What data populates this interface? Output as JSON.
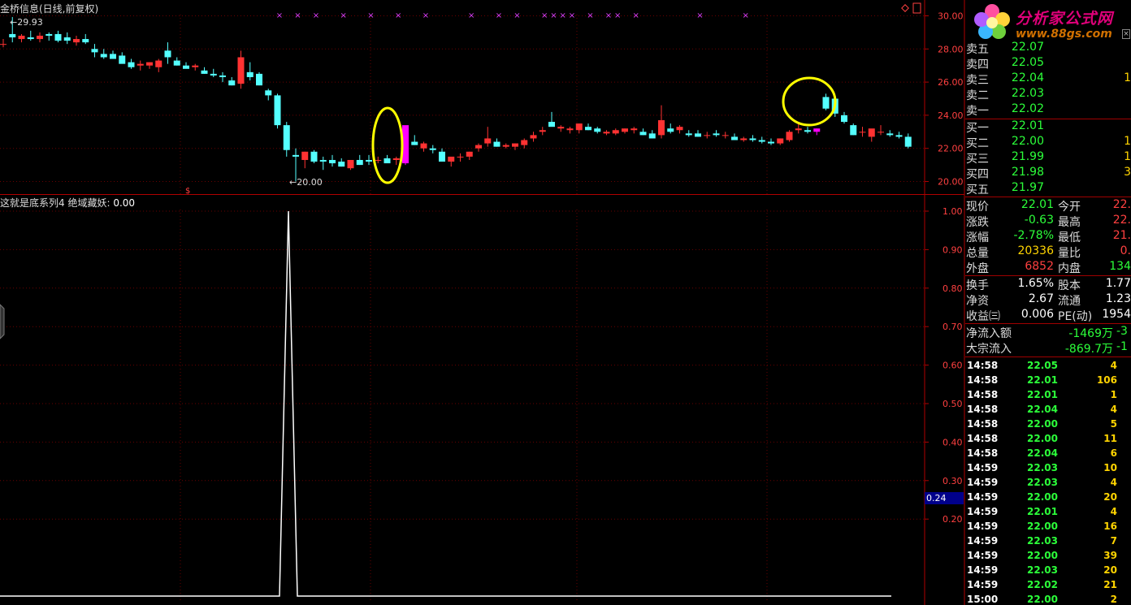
{
  "colors": {
    "background": "#000000",
    "frame": "#b00000",
    "up_candle": "#ff3232",
    "down_candle": "#54ffff",
    "signal_candle": "#ff00ff",
    "highlight_ellipse": "#ffff00",
    "indicator_line": "#ffffff",
    "gain": "#ff4040",
    "loss": "#2cff3a"
  },
  "chart": {
    "title": "金桥信息(日线,前复权)",
    "y_labels": [
      "30.00",
      "28.00",
      "26.00",
      "24.00",
      "22.00",
      "20.00"
    ],
    "y_values": [
      30,
      28,
      26,
      24,
      22,
      20
    ],
    "high_marker": "29.93",
    "low_marker": "20.00",
    "dollar_marker": "$",
    "top_right_icons": [
      "diamond-icon",
      "square-icon"
    ]
  },
  "indicator": {
    "name": "这就是底系列4",
    "series_label": "绝域藏妖:",
    "value": "0.00",
    "y_labels": [
      "1.00",
      "0.90",
      "0.80",
      "0.70",
      "0.60",
      "0.50",
      "0.40",
      "0.30",
      "0.20"
    ],
    "y_values": [
      1.0,
      0.9,
      0.8,
      0.7,
      0.6,
      0.5,
      0.4,
      0.3,
      0.2
    ],
    "current_value": "0.24"
  },
  "chart_data": {
    "type": "candlestick",
    "title": "金桥信息(日线,前复权)",
    "ylim": [
      19.2,
      30.4
    ],
    "ohlc": [
      [
        28.3,
        28.6,
        28.1,
        28.3
      ],
      [
        28.9,
        29.93,
        28.4,
        28.7
      ],
      [
        28.6,
        28.9,
        28.4,
        28.8
      ],
      [
        28.7,
        29.1,
        28.5,
        28.6
      ],
      [
        28.6,
        29.0,
        28.4,
        28.8
      ],
      [
        28.9,
        29.0,
        28.5,
        28.8
      ],
      [
        28.9,
        29.1,
        28.4,
        28.5
      ],
      [
        28.7,
        29.0,
        28.3,
        28.5
      ],
      [
        28.4,
        28.8,
        28.2,
        28.6
      ],
      [
        28.6,
        28.9,
        28.3,
        28.4
      ],
      [
        28.0,
        28.3,
        27.5,
        27.8
      ],
      [
        27.7,
        28.0,
        27.4,
        27.5
      ],
      [
        27.7,
        27.9,
        27.4,
        27.4
      ],
      [
        27.6,
        27.8,
        27.2,
        27.1
      ],
      [
        27.2,
        27.4,
        26.8,
        26.9
      ],
      [
        27.0,
        27.3,
        26.7,
        27.1
      ],
      [
        27.0,
        27.2,
        26.8,
        27.2
      ],
      [
        26.9,
        27.4,
        26.6,
        27.3
      ],
      [
        27.9,
        28.4,
        27.1,
        27.5
      ],
      [
        27.3,
        27.5,
        27.0,
        27.0
      ],
      [
        27.0,
        27.2,
        26.9,
        26.8
      ],
      [
        26.9,
        27.1,
        26.7,
        27.0
      ],
      [
        26.7,
        26.9,
        26.5,
        26.5
      ],
      [
        26.5,
        26.8,
        26.3,
        26.4
      ],
      [
        26.4,
        26.6,
        26.0,
        26.3
      ],
      [
        26.1,
        26.3,
        25.8,
        25.8
      ],
      [
        25.9,
        27.9,
        25.6,
        27.5
      ],
      [
        26.6,
        27.2,
        26.1,
        26.3
      ],
      [
        26.5,
        26.6,
        25.8,
        25.8
      ],
      [
        25.5,
        25.6,
        24.9,
        25.2
      ],
      [
        25.2,
        25.3,
        23.2,
        23.4
      ],
      [
        23.4,
        23.6,
        21.5,
        21.9
      ],
      [
        21.6,
        22.0,
        20.0,
        21.5
      ],
      [
        21.3,
        21.8,
        20.8,
        21.8
      ],
      [
        21.8,
        21.9,
        21.1,
        21.2
      ],
      [
        21.3,
        21.5,
        20.7,
        21.2
      ],
      [
        21.3,
        21.6,
        20.9,
        21.1
      ],
      [
        21.2,
        21.4,
        20.9,
        20.9
      ],
      [
        20.8,
        21.2,
        20.7,
        21.3
      ],
      [
        21.3,
        21.6,
        21.0,
        21.0
      ],
      [
        21.3,
        21.6,
        21.0,
        21.2
      ],
      [
        21.3,
        21.5,
        21.1,
        21.3
      ],
      [
        21.4,
        21.6,
        21.2,
        21.1
      ],
      [
        21.3,
        21.5,
        21.0,
        21.4
      ],
      [
        21.1,
        23.3,
        21.0,
        23.4
      ],
      [
        22.4,
        22.8,
        22.2,
        22.2
      ],
      [
        22.0,
        22.4,
        21.8,
        22.3
      ],
      [
        22.0,
        22.2,
        21.7,
        21.9
      ],
      [
        21.8,
        22.0,
        21.4,
        21.2
      ],
      [
        21.2,
        21.4,
        20.9,
        21.5
      ],
      [
        21.5,
        21.7,
        21.2,
        21.5
      ],
      [
        21.5,
        21.8,
        21.3,
        21.8
      ],
      [
        22.0,
        22.3,
        21.8,
        22.2
      ],
      [
        22.3,
        23.3,
        22.1,
        22.6
      ],
      [
        22.4,
        22.6,
        22.1,
        22.1
      ],
      [
        22.1,
        22.3,
        22.0,
        22.2
      ],
      [
        22.1,
        22.3,
        21.9,
        22.3
      ],
      [
        22.2,
        22.6,
        22.0,
        22.5
      ],
      [
        22.6,
        23.0,
        22.4,
        22.8
      ],
      [
        23.0,
        23.3,
        22.8,
        23.1
      ],
      [
        23.6,
        24.2,
        23.4,
        23.3
      ],
      [
        23.2,
        23.4,
        23.0,
        23.3
      ],
      [
        23.1,
        23.3,
        22.9,
        23.2
      ],
      [
        23.1,
        23.4,
        22.9,
        23.5
      ],
      [
        23.3,
        23.5,
        23.1,
        23.1
      ],
      [
        23.2,
        23.3,
        22.9,
        23.0
      ],
      [
        22.9,
        23.1,
        22.8,
        23.0
      ],
      [
        22.9,
        23.2,
        22.8,
        23.1
      ],
      [
        23.0,
        23.2,
        22.9,
        23.2
      ],
      [
        23.1,
        23.3,
        22.9,
        23.2
      ],
      [
        23.0,
        23.2,
        22.8,
        22.8
      ],
      [
        22.9,
        23.1,
        22.6,
        22.6
      ],
      [
        22.8,
        24.6,
        22.6,
        23.7
      ],
      [
        23.2,
        23.5,
        22.9,
        23.0
      ],
      [
        23.1,
        23.4,
        22.9,
        23.3
      ],
      [
        22.9,
        23.1,
        22.7,
        22.8
      ],
      [
        22.9,
        23.1,
        22.7,
        22.7
      ],
      [
        22.8,
        23.0,
        22.6,
        22.8
      ],
      [
        22.9,
        23.1,
        22.7,
        22.8
      ],
      [
        22.8,
        23.0,
        22.6,
        22.8
      ],
      [
        22.7,
        22.9,
        22.5,
        22.5
      ],
      [
        22.5,
        22.7,
        22.4,
        22.6
      ],
      [
        22.6,
        22.8,
        22.4,
        22.5
      ],
      [
        22.5,
        22.7,
        22.3,
        22.4
      ],
      [
        22.4,
        22.6,
        22.2,
        22.3
      ],
      [
        22.3,
        22.6,
        22.2,
        22.6
      ],
      [
        22.5,
        23.1,
        22.4,
        23.0
      ],
      [
        23.1,
        23.6,
        22.9,
        23.2
      ],
      [
        23.1,
        23.3,
        22.9,
        23.0
      ],
      [
        23.0,
        23.2,
        22.8,
        23.2
      ],
      [
        25.1,
        25.3,
        24.3,
        24.4
      ],
      [
        25.0,
        25.1,
        23.9,
        24.1
      ],
      [
        24.0,
        24.2,
        23.5,
        23.6
      ],
      [
        23.4,
        23.5,
        22.8,
        22.8
      ],
      [
        23.0,
        23.3,
        22.7,
        23.0
      ],
      [
        22.7,
        23.1,
        22.4,
        23.2
      ],
      [
        23.0,
        23.4,
        22.8,
        23.0
      ],
      [
        22.9,
        23.1,
        22.7,
        22.8
      ],
      [
        22.8,
        23.0,
        22.6,
        22.7
      ],
      [
        22.7,
        22.9,
        22.0,
        22.1
      ]
    ],
    "indicator_series": {
      "name": "绝域藏妖",
      "ylim": [
        0.0,
        1.05
      ],
      "peak_index": 32,
      "peak_value": 1.0
    }
  },
  "quote": {
    "logo_title": "分析家公式网",
    "logo_url": "www.88gs.com",
    "close_glyph": "×",
    "asks": [
      {
        "label": "卖五",
        "price": "22.07",
        "vol": ""
      },
      {
        "label": "卖四",
        "price": "22.05",
        "vol": ""
      },
      {
        "label": "卖三",
        "price": "22.04",
        "vol": "1"
      },
      {
        "label": "卖二",
        "price": "22.03",
        "vol": ""
      },
      {
        "label": "卖一",
        "price": "22.02",
        "vol": ""
      }
    ],
    "bids": [
      {
        "label": "买一",
        "price": "22.01",
        "vol": ""
      },
      {
        "label": "买二",
        "price": "22.00",
        "vol": "1"
      },
      {
        "label": "买三",
        "price": "21.99",
        "vol": "1"
      },
      {
        "label": "买四",
        "price": "21.98",
        "vol": "3"
      },
      {
        "label": "买五",
        "price": "21.97",
        "vol": ""
      }
    ],
    "stats_a": [
      {
        "l1": "现价",
        "v1": "22.01",
        "l2": "今开",
        "v2": "22."
      },
      {
        "l1": "涨跌",
        "v1": "-0.63",
        "l2": "最高",
        "v2": "22."
      },
      {
        "l1": "涨幅",
        "v1": "-2.78%",
        "l2": "最低",
        "v2": "21."
      },
      {
        "l1": "总量",
        "v1": "20336",
        "l2": "量比",
        "v2": "0."
      },
      {
        "l1": "外盘",
        "v1": "6852",
        "l2": "内盘",
        "v2": "134"
      }
    ],
    "stats_b": [
      {
        "l1": "换手",
        "v1": "1.65%",
        "l2": "股本",
        "v2": "1.77"
      },
      {
        "l1": "净资",
        "v1": "2.67",
        "l2": "流通",
        "v2": "1.23"
      },
      {
        "l1": "收益㈢",
        "v1": "0.006",
        "l2": "PE(动)",
        "v2": "1954"
      }
    ],
    "flows": [
      {
        "label": "净流入额",
        "v1": "-1469万",
        "v2": "-3"
      },
      {
        "label": "大宗流入",
        "v1": "-869.7万",
        "v2": "-1"
      }
    ],
    "ticks": [
      {
        "time": "14:58",
        "price": "22.05",
        "vol": "4"
      },
      {
        "time": "14:58",
        "price": "22.01",
        "vol": "106"
      },
      {
        "time": "14:58",
        "price": "22.01",
        "vol": "1"
      },
      {
        "time": "14:58",
        "price": "22.04",
        "vol": "4"
      },
      {
        "time": "14:58",
        "price": "22.00",
        "vol": "5"
      },
      {
        "time": "14:58",
        "price": "22.00",
        "vol": "11"
      },
      {
        "time": "14:58",
        "price": "22.04",
        "vol": "6"
      },
      {
        "time": "14:59",
        "price": "22.03",
        "vol": "10"
      },
      {
        "time": "14:59",
        "price": "22.03",
        "vol": "4"
      },
      {
        "time": "14:59",
        "price": "22.00",
        "vol": "20"
      },
      {
        "time": "14:59",
        "price": "22.01",
        "vol": "4"
      },
      {
        "time": "14:59",
        "price": "22.00",
        "vol": "16"
      },
      {
        "time": "14:59",
        "price": "22.03",
        "vol": "7"
      },
      {
        "time": "14:59",
        "price": "22.00",
        "vol": "39"
      },
      {
        "time": "14:59",
        "price": "22.03",
        "vol": "20"
      },
      {
        "time": "14:59",
        "price": "22.02",
        "vol": "21"
      },
      {
        "time": "15:00",
        "price": "22.00",
        "vol": "2"
      }
    ]
  }
}
